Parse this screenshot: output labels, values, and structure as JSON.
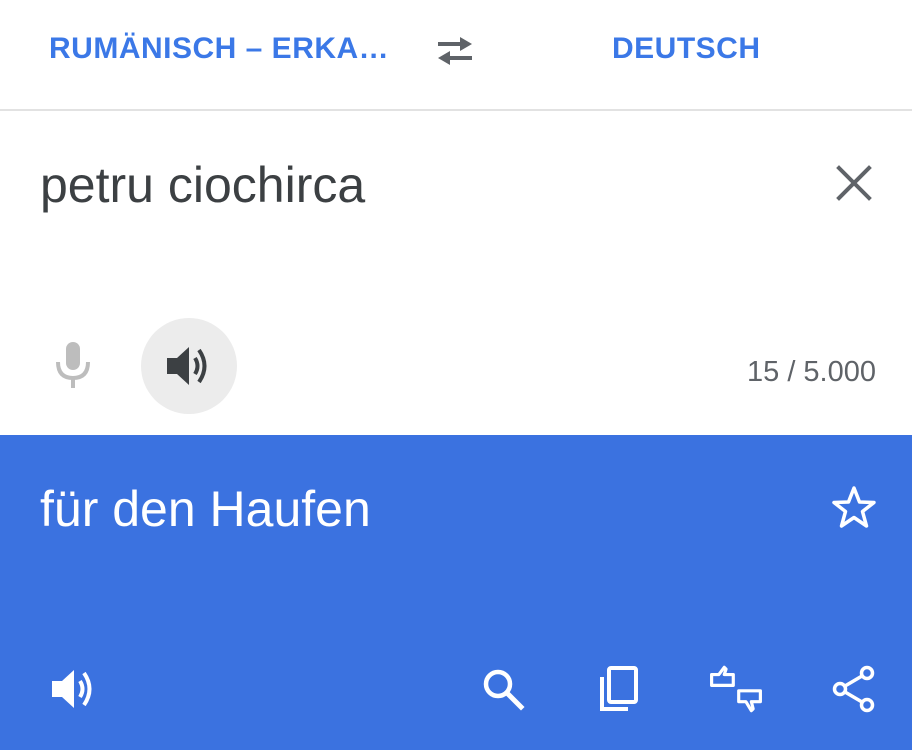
{
  "language_bar": {
    "source_language": "RUMÄNISCH – ERKA…",
    "target_language": "DEUTSCH",
    "swap_icon": "swap-arrows-icon"
  },
  "input": {
    "text": "petru ciochirca",
    "char_count": "15 / 5.000",
    "icons": [
      "close-icon",
      "microphone-icon",
      "speaker-icon"
    ]
  },
  "output": {
    "text": "für den Haufen",
    "icons": [
      "star-icon",
      "speaker-icon",
      "search-icon",
      "copy-icon",
      "feedback-icon",
      "share-icon"
    ]
  },
  "colors": {
    "accent": "#3b78e7",
    "output_background": "#3b72e0",
    "source_text": "#3c4043",
    "muted": "#5f6368"
  }
}
